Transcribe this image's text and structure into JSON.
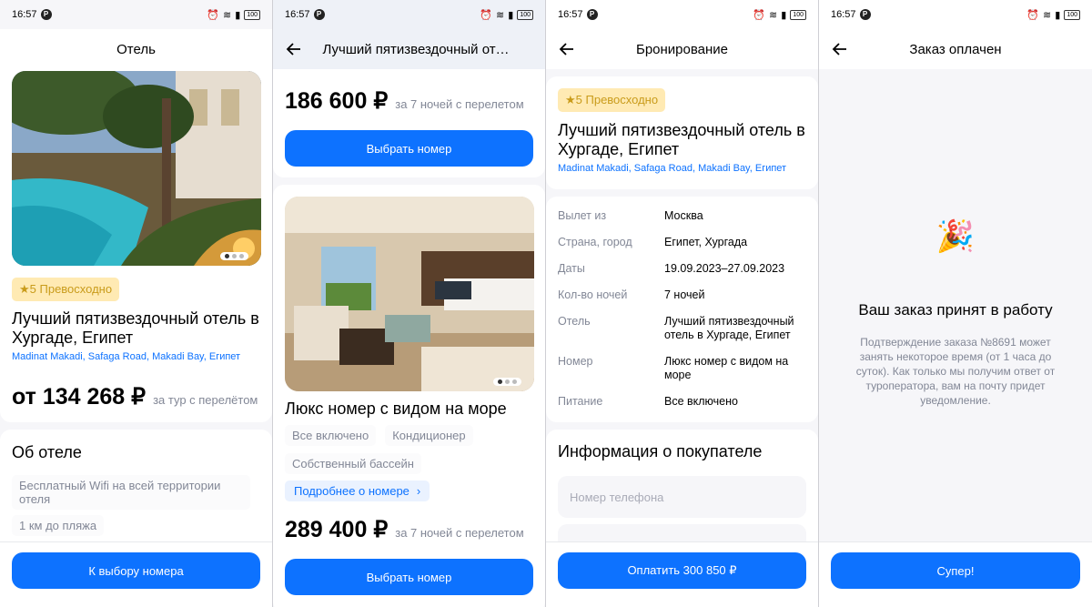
{
  "status": {
    "time": "16:57",
    "battery": "100"
  },
  "screen1": {
    "title": "Отель",
    "rating": "★5 Превосходно",
    "hotel_name": "Лучший пятизвездочный отель в Хургаде, Египет",
    "address": "Madinat Makadi, Safaga Road, Makadi Bay, Египет",
    "price": "от 134 268 ₽",
    "price_note": "за тур с перелётом",
    "about_title": "Об отеле",
    "features": [
      "Бесплатный Wifi на всей территории отеля",
      "1 км до пляжа"
    ],
    "button": "К выбору номера"
  },
  "screen2": {
    "title": "Лучший пятизвездочный отель ...",
    "room1_price": "186 600 ₽",
    "room1_note": "за 7 ночей с перелетом",
    "room1_button": "Выбрать номер",
    "room2_name": "Люкс номер с видом на море",
    "room2_tags": [
      "Все включено",
      "Кондиционер",
      "Собственный бассейн"
    ],
    "room2_more": "Подробнее о номере",
    "room2_price": "289 400 ₽",
    "room2_note": "за 7 ночей с перелетом",
    "room2_button": "Выбрать номер"
  },
  "screen3": {
    "title": "Бронирование",
    "rating": "★5 Превосходно",
    "hotel_name": "Лучший пятизвездочный отель в Хургаде, Египет",
    "address": "Madinat Makadi, Safaga Road, Makadi Bay, Египет",
    "details": [
      {
        "k": "Вылет из",
        "v": "Москва"
      },
      {
        "k": "Страна, город",
        "v": "Египет, Хургада"
      },
      {
        "k": "Даты",
        "v": "19.09.2023–27.09.2023"
      },
      {
        "k": "Кол-во ночей",
        "v": "7 ночей"
      },
      {
        "k": "Отель",
        "v": "Лучший пятизвездочный отель в Хургаде, Египет"
      },
      {
        "k": "Номер",
        "v": "Люкс номер с видом на море"
      },
      {
        "k": "Питание",
        "v": "Все включено"
      }
    ],
    "buyer_title": "Информация о покупателе",
    "phone_placeholder": "Номер телефона",
    "pay_button": "Оплатить 300 850 ₽"
  },
  "screen4": {
    "title": "Заказ оплачен",
    "emoji": "🎉",
    "heading": "Ваш заказ принят в работу",
    "message": "Подтверждение заказа №8691 может занять некоторое время (от 1 часа до суток). Как только мы получим ответ от туроператора, вам на почту придет уведомление.",
    "button": "Супер!"
  }
}
